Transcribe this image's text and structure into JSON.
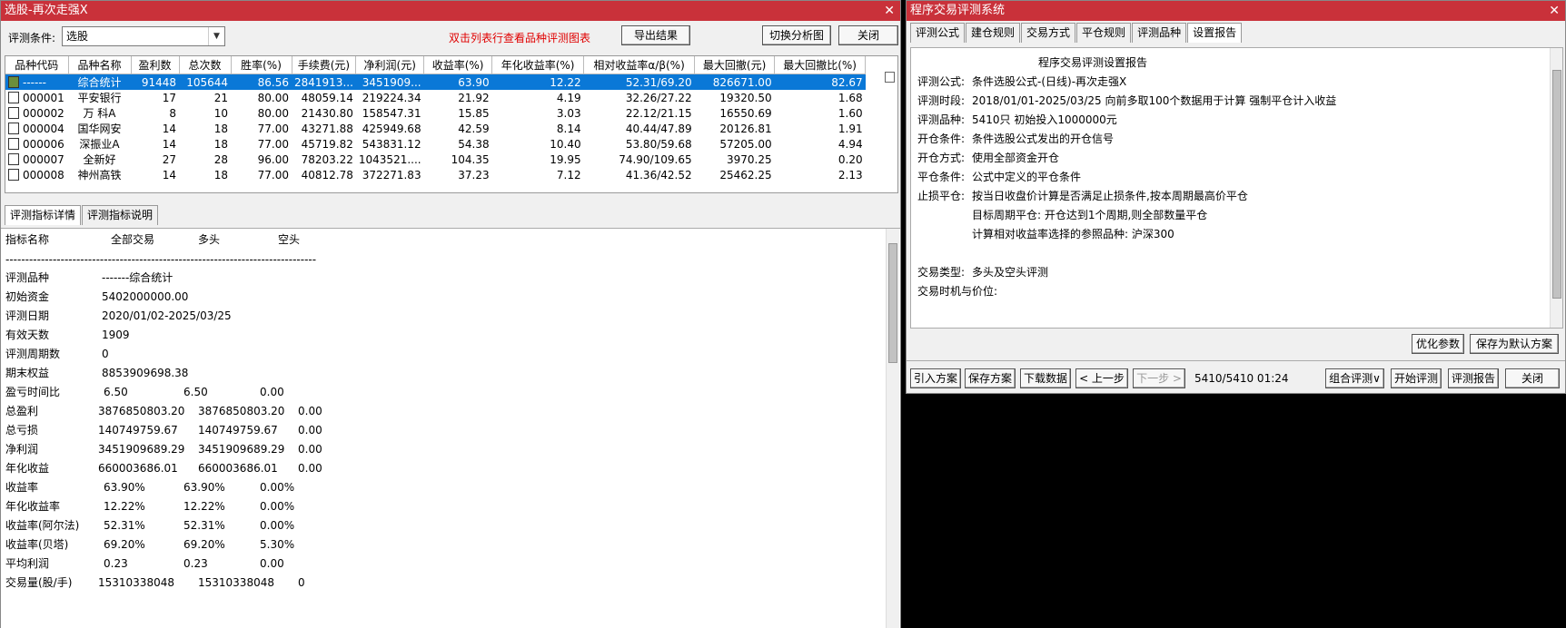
{
  "left": {
    "title": "选股-再次走强X",
    "cond_label": "评测条件:",
    "cond_value": "选股",
    "hint": "双击列表行查看品种评测图表",
    "btn_export": "导出结果",
    "btn_switch": "切换分析图",
    "btn_close": "关闭",
    "columns": [
      "品种代码",
      "品种名称",
      "盈利数",
      "总次数",
      "胜率(%)",
      "手续费(元)",
      "净利润(元)",
      "收益率(%)",
      "年化收益率(%)",
      "相对收益率α/β(%)",
      "最大回撤(元)",
      "最大回撤比(%)"
    ],
    "rows": [
      [
        "------",
        "综合统计",
        "91448",
        "105644",
        "86.56",
        "2841913...",
        "3451909...",
        "63.90",
        "12.22",
        "52.31/69.20",
        "826671.00",
        "82.67"
      ],
      [
        "000001",
        "平安银行",
        "17",
        "21",
        "80.00",
        "48059.14",
        "219224.34",
        "21.92",
        "4.19",
        "32.26/27.22",
        "19320.50",
        "1.68"
      ],
      [
        "000002",
        "万 科A",
        "8",
        "10",
        "80.00",
        "21430.80",
        "158547.31",
        "15.85",
        "3.03",
        "22.12/21.15",
        "16550.69",
        "1.60"
      ],
      [
        "000004",
        "国华网安",
        "14",
        "18",
        "77.00",
        "43271.88",
        "425949.68",
        "42.59",
        "8.14",
        "40.44/47.89",
        "20126.81",
        "1.91"
      ],
      [
        "000006",
        "深振业A",
        "14",
        "18",
        "77.00",
        "45719.82",
        "543831.12",
        "54.38",
        "10.40",
        "53.80/59.68",
        "57205.00",
        "4.94"
      ],
      [
        "000007",
        "全新好",
        "27",
        "28",
        "96.00",
        "78203.22",
        "1043521....",
        "104.35",
        "19.95",
        "74.90/109.65",
        "3970.25",
        "0.20"
      ],
      [
        "000008",
        "神州高铁",
        "14",
        "18",
        "77.00",
        "40812.78",
        "372271.83",
        "37.23",
        "7.12",
        "41.36/42.52",
        "25462.25",
        "2.13"
      ]
    ],
    "tabs": [
      "评测指标详情",
      "评测指标说明"
    ],
    "detail_header": [
      "指标名称",
      "全部交易",
      "多头",
      "空头"
    ],
    "detail_rule": "-------------------------------------------------------------------------------",
    "detail": [
      [
        "评测品种",
        "-------综合统计",
        "",
        ""
      ],
      [
        "初始资金",
        "5402000000.00",
        "",
        ""
      ],
      [
        "评测日期",
        "2020/01/02-2025/03/25",
        "",
        ""
      ],
      [
        "有效天数",
        "1909",
        "",
        ""
      ],
      [
        "评测周期数",
        "0",
        "",
        ""
      ],
      [
        "期末权益",
        "8853909698.38",
        "",
        ""
      ],
      [
        "盈亏时间比",
        "6.50",
        "6.50",
        "0.00"
      ],
      [
        "总盈利",
        "3876850803.20",
        "3876850803.20",
        "0.00"
      ],
      [
        "总亏损",
        "140749759.67",
        "140749759.67",
        "0.00"
      ],
      [
        "净利润",
        "3451909689.29",
        "3451909689.29",
        "0.00"
      ],
      [
        "年化收益",
        "660003686.01",
        "660003686.01",
        "0.00"
      ],
      [
        "收益率",
        "63.90%",
        "63.90%",
        "0.00%"
      ],
      [
        "年化收益率",
        "12.22%",
        "12.22%",
        "0.00%"
      ],
      [
        "收益率(阿尔法)",
        "52.31%",
        "52.31%",
        "0.00%"
      ],
      [
        "收益率(贝塔)",
        "69.20%",
        "69.20%",
        "5.30%"
      ],
      [
        "平均利润",
        "0.23",
        "0.23",
        "0.00"
      ],
      [
        "交易量(股/手)",
        "15310338048",
        "15310338048",
        "0"
      ]
    ]
  },
  "right": {
    "title": "程序交易评测系统",
    "tabs": [
      "评测公式",
      "建仓规则",
      "交易方式",
      "平仓规则",
      "评测品种",
      "设置报告"
    ],
    "report_title": "程序交易评测设置报告",
    "report": [
      {
        "k": "评测公式:",
        "v": "条件选股公式-(日线)-再次走强X"
      },
      {
        "k": "评测时段:",
        "v": "2018/01/01-2025/03/25 向前多取100个数据用于计算 强制平仓计入收益"
      },
      {
        "k": "评测品种:",
        "v": "5410只 初始投入1000000元"
      },
      {
        "k": "开仓条件:",
        "v": "条件选股公式发出的开仓信号"
      },
      {
        "k": "开仓方式:",
        "v": "使用全部资金开仓"
      },
      {
        "k": "平仓条件:",
        "v": "公式中定义的平仓条件"
      },
      {
        "k": "止损平仓:",
        "v": "按当日收盘价计算是否满足止损条件,按本周期最高价平仓"
      },
      {
        "k": "",
        "v": "目标周期平仓: 开仓达到1个周期,则全部数量平仓"
      },
      {
        "k": "",
        "v": "计算相对收益率选择的参照品种: 沪深300"
      },
      {
        "k": "",
        "v": ""
      },
      {
        "k": "交易类型:",
        "v": "多头及空头评测"
      },
      {
        "k": "交易时机与价位:",
        "v": ""
      }
    ],
    "btn_optimize": "优化参数",
    "btn_save_default": "保存为默认方案",
    "btn_import": "引入方案",
    "btn_save": "保存方案",
    "btn_download": "下载数据",
    "btn_prev": "< 上一步",
    "btn_next": "下一步 >",
    "status": "5410/5410 01:24",
    "btn_combo": "组合评测∨",
    "btn_start": "开始评测",
    "btn_report": "评测报告",
    "btn_close": "关闭"
  }
}
